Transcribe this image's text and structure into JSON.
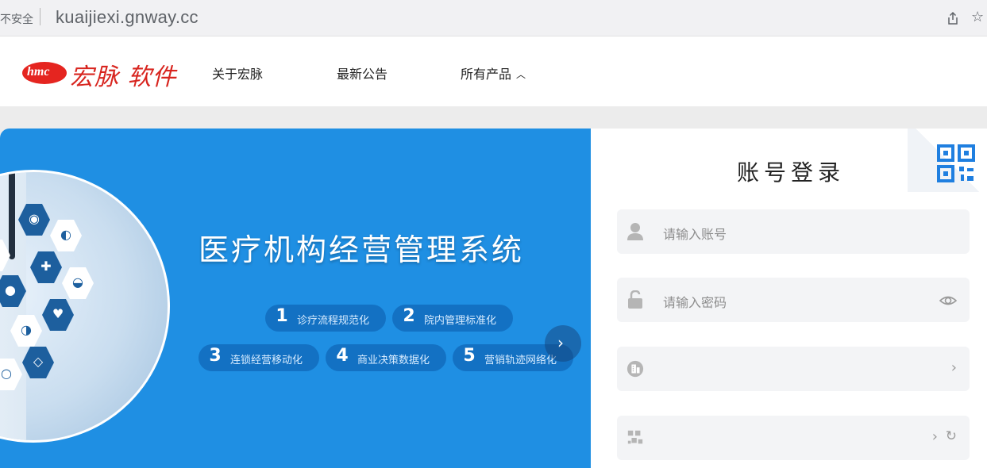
{
  "browser": {
    "insecure_label": "不安全",
    "url": "kuaijiexi.gnway.cc"
  },
  "header": {
    "logo_mark": "hmc",
    "logo_text": "宏脉 软件",
    "nav": {
      "about": "关于宏脉",
      "news": "最新公告",
      "products": "所有产品"
    }
  },
  "banner": {
    "title": "医疗机构经营管理系统",
    "features": [
      {
        "num": "1",
        "text": "诊疗流程规范化"
      },
      {
        "num": "2",
        "text": "院内管理标准化"
      },
      {
        "num": "3",
        "text": "连锁经营移动化"
      },
      {
        "num": "4",
        "text": "商业决策数据化"
      },
      {
        "num": "5",
        "text": "营销轨迹网络化"
      }
    ]
  },
  "login": {
    "title": "账号登录",
    "account_placeholder": "请输入账号",
    "password_placeholder": "请输入密码"
  },
  "colors": {
    "brand_red": "#d8251f",
    "banner_blue": "#1f8fe3",
    "qr_blue": "#1f7fe0"
  },
  "icons": [
    "share-icon",
    "star-icon",
    "user-icon",
    "lock-icon",
    "eye-icon",
    "building-icon",
    "captcha-icon",
    "qr-code-icon",
    "chevron-right-icon",
    "refresh-icon",
    "caret-up-icon"
  ]
}
